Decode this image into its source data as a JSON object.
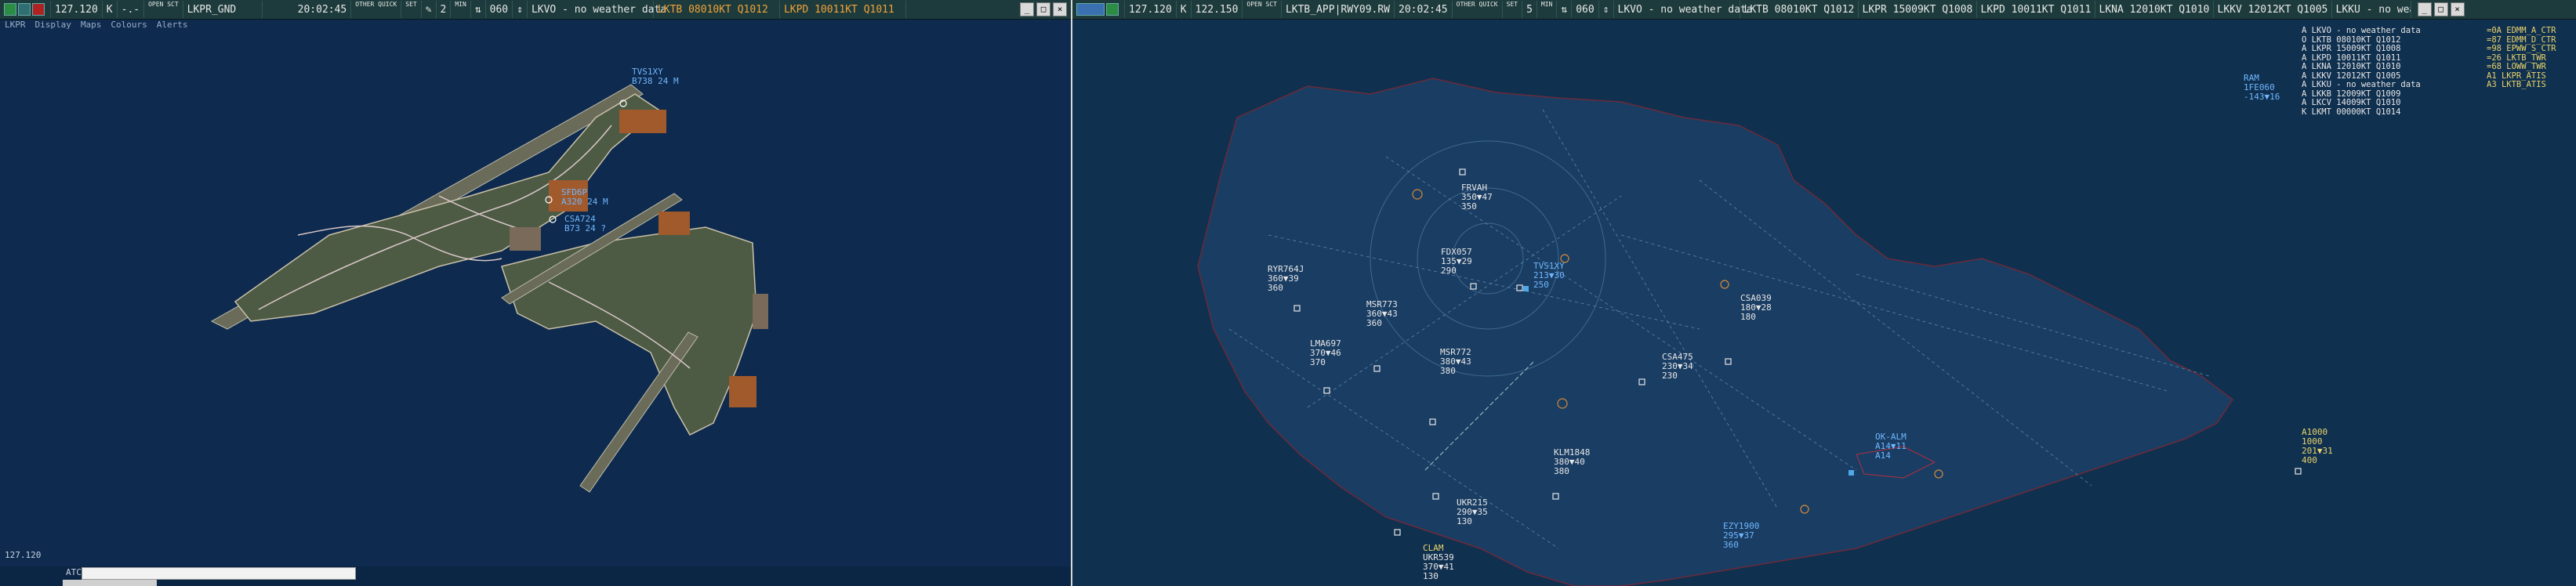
{
  "left": {
    "topbar": {
      "frequency": "127.120",
      "k": "K",
      "dash": "-.-",
      "open_sct": "OPEN\nSCT",
      "position": "LKPR_GND",
      "time": "20:02:45",
      "other_quick": "OTHER QUICK",
      "set": "SET",
      "set2": "SET",
      "range_num": "2",
      "range_unit": "MIN",
      "heading": "060",
      "weather_lkvo": "LKVO - no weather data",
      "metar_lktb": "LKTB 08010KT Q1012",
      "metar_lkpd": "LKPD 10011KT Q1011"
    },
    "menu": [
      "LKPR",
      "Display",
      "Maps",
      "Colours",
      "Alerts"
    ],
    "aircraft": [
      {
        "callsign": "TVS1XY",
        "info": "B738 24 M"
      },
      {
        "callsign": "SFD6P",
        "info": "A320 24 M"
      },
      {
        "callsign": "CSA724",
        "info": "B73 24 ?"
      }
    ],
    "frequency_footer": "127.120",
    "atc_label": "ATC"
  },
  "right": {
    "topbar": {
      "frequency": "127.120",
      "k": "K",
      "frequency2": "122.150",
      "open_sct": "OPEN\nSCT",
      "position": "LKTB_APP|RWY09.RW",
      "time": "20:02:45",
      "other_quick": "OTHER QUICK",
      "set": "SET",
      "set2": "SET",
      "range_num": "5",
      "range_unit": "MIN",
      "heading": "060",
      "weather_lkvo": "LKVO - no weather data",
      "metar_lktb": "LKTB 08010KT Q1012",
      "metar_lkpr": "LKPR 15009KT Q1008",
      "metar_lkpd": "LKPD 10011KT Q1011",
      "metar_lkna": "LKNA 12010KT Q1010",
      "metar_lkkv": "LKKV 12012KT Q1005",
      "metar_lkku": "LKKU - no weather data"
    },
    "metar_list": [
      "A LKVO - no weather data",
      "O LKTB 08010KT Q1012",
      "A LKPR 15009KT Q1008",
      "A LKPD 10011KT Q1011",
      "A LKNA 12010KT Q1010",
      "A LKKV 12012KT Q1005",
      "A LKKU - no weather data",
      "A LKKB 12009KT Q1009",
      "A LKCV 14009KT Q1010",
      "K LKMT 00000KT Q1014"
    ],
    "controller_list": [
      "=0A EDMM_A_CTR",
      "=87 EDMM_D_CTR",
      "=98 EPWW_S_CTR",
      "=26 LKTB_TWR",
      "=68 LOWW_TWR",
      "A1 LKPR_ATIS",
      "A3 LKTB_ATIS"
    ],
    "aircraft": [
      {
        "callsign": "FRVAH",
        "info": "350▼47\n350"
      },
      {
        "callsign": "FDX057",
        "info": "135▼29\n290"
      },
      {
        "callsign": "TVS1XY",
        "info": "213▼30\n250"
      },
      {
        "callsign": "RYR764J",
        "info": "360▼39\n360"
      },
      {
        "callsign": "MSR773",
        "info": "360▼43\n360"
      },
      {
        "callsign": "LMA697",
        "info": "370▼46\n370"
      },
      {
        "callsign": "MSR772",
        "info": "380▼43\n380"
      },
      {
        "callsign": "CSA475",
        "info": "230▼34\n230"
      },
      {
        "callsign": "CSA039",
        "info": "180▼28\n180"
      },
      {
        "callsign": "KLM1848",
        "info": "380▼40\n380"
      },
      {
        "callsign": "UKR215",
        "info": "290▼35\n130"
      },
      {
        "callsign": "EZY1900",
        "info": "295▼37\n360"
      },
      {
        "callsign": "UKR539",
        "info": "370▼41\n130"
      },
      {
        "callsign": "OK-ALM",
        "info": "A14▼11\nA14"
      },
      {
        "callsign": "A1000",
        "info": "1000\n201▼31\n400"
      },
      {
        "callsign": "RAM",
        "info": "1FE060\n-143▼16"
      },
      {
        "callsign": "CLAM",
        "info": ""
      }
    ]
  }
}
